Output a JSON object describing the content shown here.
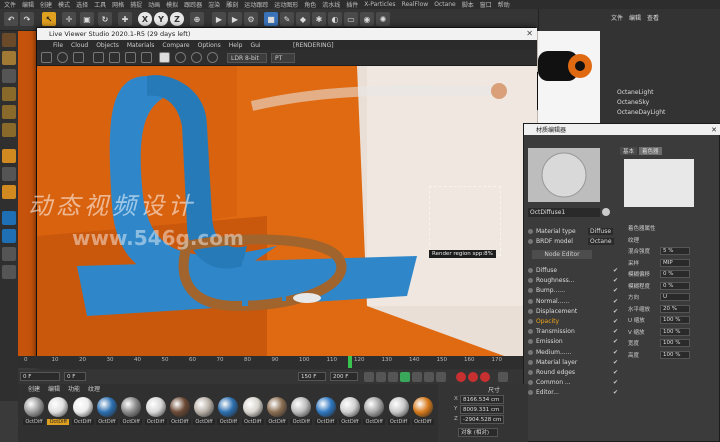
{
  "c4d_menu": [
    "文件",
    "编辑",
    "创建",
    "模式",
    "选择",
    "工具",
    "网格",
    "捕捉",
    "动画",
    "模拟",
    "跟踪器",
    "渲染",
    "雕刻",
    "运动跟踪",
    "运动图形",
    "角色",
    "流水线",
    "插件",
    "X-Particles",
    "RealFlow",
    "Octane",
    "脚本",
    "窗口",
    "帮助"
  ],
  "toolbar_axes": [
    "X",
    "Y",
    "Z"
  ],
  "live_viewer": {
    "title": "Live Viewer Studio 2020.1-R5 (29 days left)",
    "menu": [
      "File",
      "Cloud",
      "Objects",
      "Materials",
      "Compare",
      "Options",
      "Help",
      "Gui"
    ],
    "status": "[RENDERING]",
    "kernel_select": "LDR 8-bit",
    "mode_select": "PT",
    "region_tooltip": "Render region  spp:8%"
  },
  "object_manager": {
    "tabs": [
      "文件",
      "编辑",
      "查看"
    ],
    "items": [
      "OctaneLight",
      "OctaneSky",
      "OctaneDayLight"
    ]
  },
  "material_editor": {
    "title": "材质编辑器",
    "material_name": "OctDiffuse1",
    "channels": [
      {
        "label": "Material type",
        "value": "Diffuse"
      },
      {
        "label": "BRDF model",
        "value": "Octane"
      }
    ],
    "node_editor_label": "Node Editor",
    "channel_list": [
      "Diffuse",
      "Roughness...",
      "Bump......",
      "Normal......",
      "Displacement",
      "Opacity",
      "Transmission",
      "Emission",
      "Medium......",
      "Material layer",
      "Round edges",
      "Common ...",
      "Editor..."
    ],
    "active_channel": "Opacity",
    "tabs": [
      "基本",
      "着色器"
    ],
    "props": [
      {
        "label": "着色器属性",
        "value": ""
      },
      {
        "label": "纹理",
        "value": ""
      },
      {
        "label": "混合强度",
        "value": "5 %"
      },
      {
        "label": "采样",
        "value": "MIP"
      },
      {
        "label": "模糊偏移",
        "value": "0 %"
      },
      {
        "label": "模糊程度",
        "value": "0 %"
      },
      {
        "label": "方向",
        "value": "U"
      },
      {
        "label": "水平缩放",
        "value": "20 %"
      },
      {
        "label": "U 缩放",
        "value": "100 %"
      },
      {
        "label": "V 缩放",
        "value": "100 %"
      },
      {
        "label": "宽度",
        "value": "100 %"
      },
      {
        "label": "高度",
        "value": "100 %"
      }
    ]
  },
  "timeline": {
    "ticks": [
      "0",
      "10",
      "20",
      "30",
      "40",
      "50",
      "60",
      "70",
      "80",
      "90",
      "100",
      "110",
      "120",
      "130",
      "140",
      "150",
      "160",
      "170"
    ],
    "current_frame": "116 F",
    "start": "0 F",
    "end": "150 F",
    "end2": "200 F"
  },
  "material_manager": {
    "menu": [
      "创建",
      "编辑",
      "功能",
      "纹理"
    ],
    "balls": [
      {
        "label": "OctDiff",
        "color": "#9c9c9c"
      },
      {
        "label": "OctDiff",
        "color": "#e0e0e0"
      },
      {
        "label": "OctDiff",
        "color": "#ececec"
      },
      {
        "label": "OctDiff",
        "color": "#2c6fb0"
      },
      {
        "label": "OctDiff",
        "color": "#8a8a8a"
      },
      {
        "label": "OctDiff",
        "color": "#d8d8d8"
      },
      {
        "label": "OctDiff",
        "color": "#6b4a35"
      },
      {
        "label": "OctDiff",
        "color": "#b9b1a8"
      },
      {
        "label": "OctDiff",
        "color": "#2c6fb0"
      },
      {
        "label": "OctDiff",
        "color": "#d9d5cf"
      },
      {
        "label": "OctDiff",
        "color": "#8b6e52"
      },
      {
        "label": "OctDiff",
        "color": "#bdbdbd"
      },
      {
        "label": "OctDiff",
        "color": "#2f77c0"
      },
      {
        "label": "OctDiff",
        "color": "#d0d0d0"
      },
      {
        "label": "OctDiff",
        "color": "#a6a6a6"
      },
      {
        "label": "OctDiff",
        "color": "#c9c9c9"
      },
      {
        "label": "OctDiff",
        "color": "#d67a1c"
      }
    ]
  },
  "coordinates": {
    "header": "尺寸",
    "fields": [
      {
        "axis": "X",
        "value": "8166.534 cm"
      },
      {
        "axis": "Y",
        "value": "8009.331 cm"
      },
      {
        "axis": "Z",
        "value": "-2904.528 cm"
      }
    ],
    "mode": "对象 (相对)"
  },
  "watermark": {
    "text": "动态视频设计",
    "url": "www.546g.com"
  },
  "colors": {
    "scene_orange": "#e06a12",
    "tube_blue": "#2f87c9",
    "accent_orange": "#f0a51a",
    "ui_dark": "#3a3a3a"
  }
}
